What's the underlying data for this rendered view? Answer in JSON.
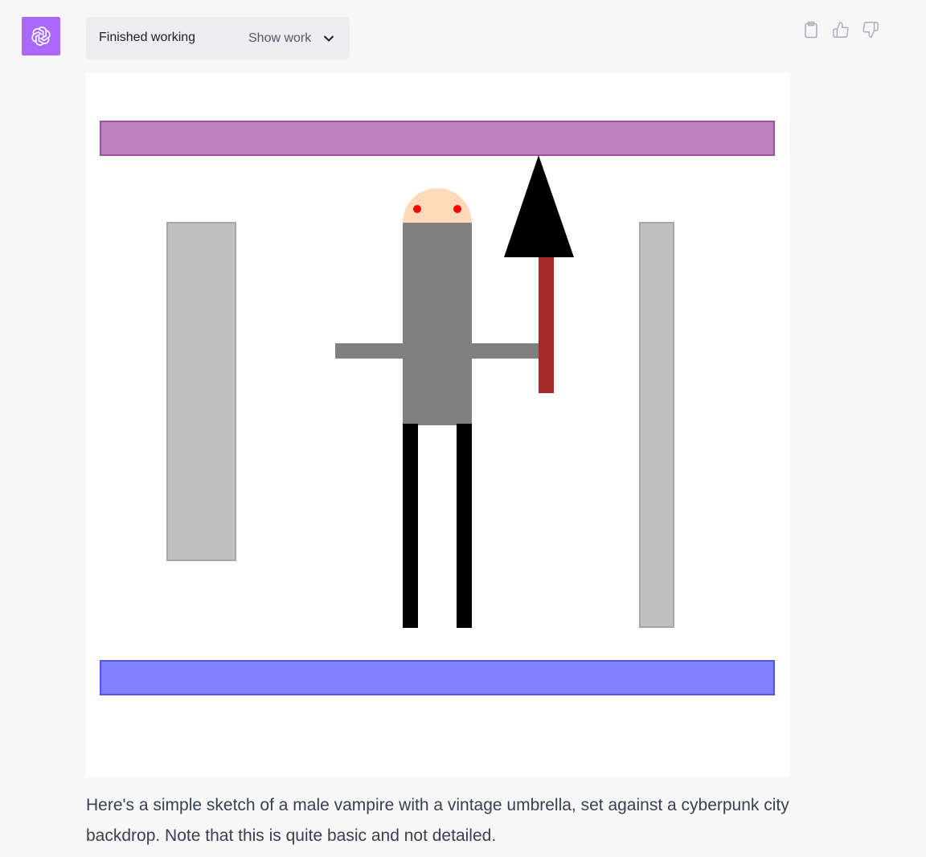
{
  "assistant": {
    "avatar_icon": "openai-logo-icon",
    "avatar_color": "#ab68ff"
  },
  "status": {
    "label": "Finished working",
    "show_work_label": "Show work"
  },
  "actions": {
    "copy_icon": "clipboard-icon",
    "like_icon": "thumbs-up-icon",
    "dislike_icon": "thumbs-down-icon"
  },
  "drawing": {
    "colors": {
      "top_bar": "#bf80bf",
      "bottom_bar": "#8080ff",
      "buildings": "#c0c0c0",
      "head": "#ffdab9",
      "eyes": "#ff0000",
      "body": "#808080",
      "legs": "#000000",
      "umbrella_canopy": "#000000",
      "umbrella_handle": "#a52a2a"
    }
  },
  "message": {
    "text": "Here's a simple sketch of a male vampire with a vintage umbrella, set against a cyberpunk city backdrop. Note that this is quite basic and not detailed."
  }
}
